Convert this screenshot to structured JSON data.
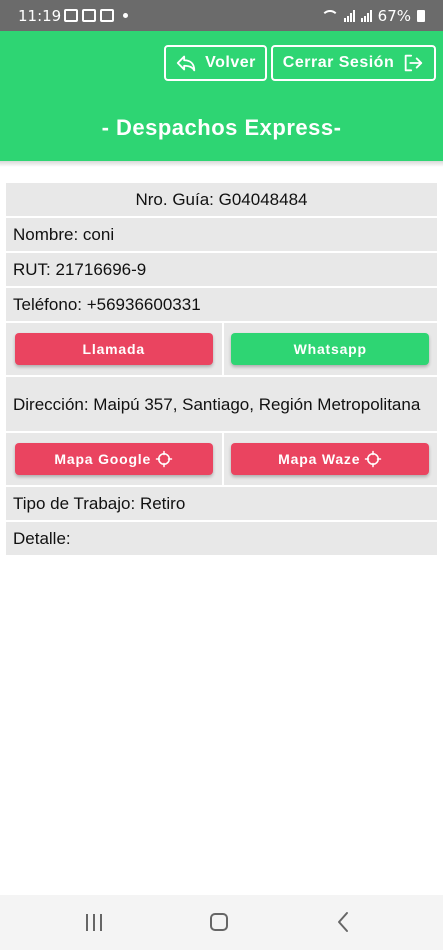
{
  "status_bar": {
    "time": "11:19",
    "battery": "67%",
    "icons": [
      "image-icon",
      "mail-icon",
      "mail-icon",
      "dot-icon",
      "wifi-icon",
      "signal-icon",
      "signal-icon",
      "battery-icon"
    ]
  },
  "header": {
    "back_label": "Volver",
    "logout_label": "Cerrar Sesión",
    "title": "- Despachos Express-",
    "color": "#2ed573"
  },
  "details": {
    "guia": "Nro. Guía: G04048484",
    "nombre": "Nombre: coni",
    "rut": "RUT: 21716696-9",
    "telefono": "Teléfono: +56936600331",
    "direccion": "Dirección: Maipú 357, Santiago, Región Metropolitana",
    "tipo_trabajo": "Tipo de Trabajo: Retiro",
    "detalle": "Detalle:"
  },
  "actions": {
    "call_label": "Llamada",
    "whatsapp_label": "Whatsapp",
    "google_label": "Mapa Google",
    "waze_label": "Mapa Waze",
    "red_color": "#ea4460",
    "green_color": "#2ed573"
  }
}
